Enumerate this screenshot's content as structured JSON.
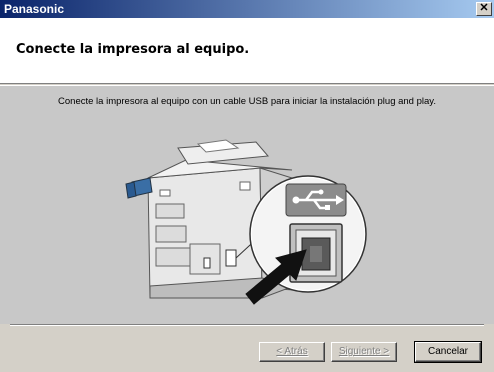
{
  "window": {
    "title": "Panasonic",
    "close_label": "✕"
  },
  "header": {
    "title": "Conecte la impresora al equipo."
  },
  "content": {
    "instruction": "Conecte la impresora al equipo con un cable USB para iniciar la instalación plug and play.",
    "illustration_icons": [
      "printer-icon",
      "usb-symbol-icon",
      "usb-port-icon",
      "arrow-icon"
    ]
  },
  "buttons": {
    "back": "< Atrás",
    "next": "Siguiente >",
    "cancel": "Cancelar"
  },
  "colors": {
    "titlebar_start": "#0a246a",
    "titlebar_end": "#a6caf0",
    "content_bg": "#c8c8c8",
    "face": "#d4d0c8"
  }
}
